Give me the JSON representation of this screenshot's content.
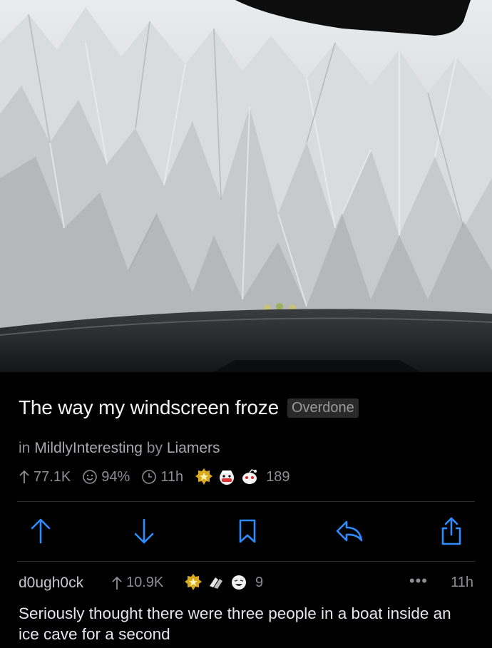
{
  "post": {
    "title": "The way my windscreen froze",
    "flair": "Overdone",
    "in_label": "in",
    "subreddit": "MildlyInteresting",
    "by_label": "by",
    "author": "Liamers",
    "upvotes": "77.1K",
    "upvote_ratio": "94%",
    "age": "11h",
    "award_count": "189",
    "image_alt": "Frost crystals covering a car windscreen"
  },
  "actions": {
    "upvote_icon": "arrow-up-icon",
    "downvote_icon": "arrow-down-icon",
    "save_icon": "bookmark-icon",
    "reply_icon": "reply-icon",
    "share_icon": "share-icon"
  },
  "comment": {
    "author": "d0ugh0ck",
    "score": "10.9K",
    "award_count": "9",
    "more": "•••",
    "age": "11h",
    "body": "Seriously thought there were three people in a boat inside an ice cave for a second"
  },
  "colors": {
    "accent": "#2f8cff",
    "meta": "#8e8e93",
    "flair_bg": "#2a2a2a"
  }
}
